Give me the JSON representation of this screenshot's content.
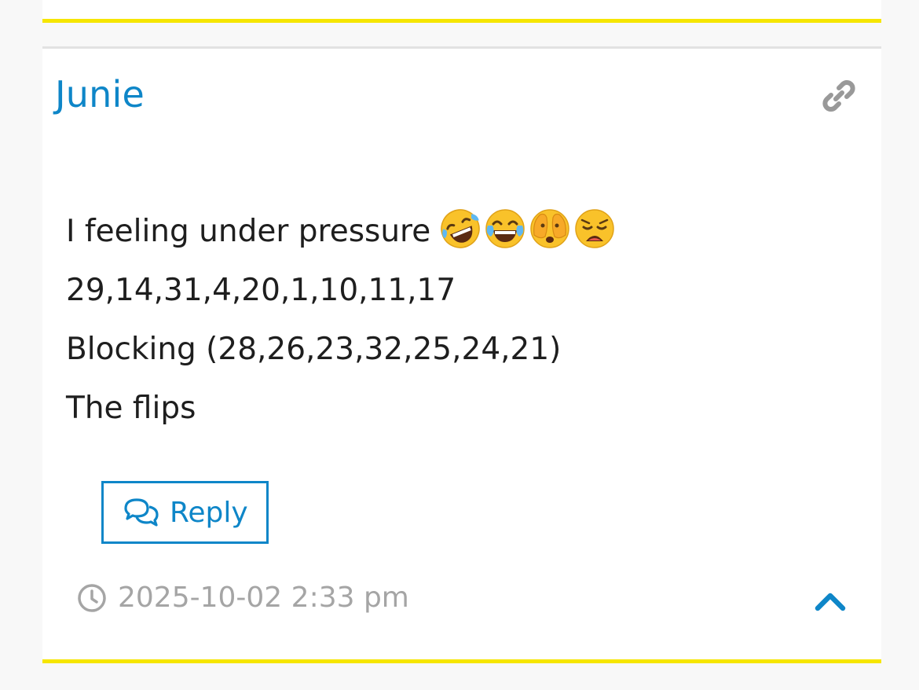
{
  "post": {
    "author": "Junie",
    "lines": [
      "I feeling under pressure",
      "29,14,31,4,20,1,10,11,17",
      "Blocking (28,26,23,32,25,24,21)",
      "The flips"
    ],
    "emojis": [
      "rolling-on-floor-laughing",
      "tears-of-joy",
      "face-with-open-eyes-and-hand-over-mouth",
      "weary-face"
    ],
    "reply_label": "Reply",
    "timestamp": "2025-10-02 2:33 pm"
  },
  "icons": {
    "permalink": "link-icon",
    "reply": "chat-bubbles-icon",
    "time": "clock-icon",
    "scroll_top": "chevron-up-icon"
  },
  "colors": {
    "accent": "#0e86c8",
    "highlight_border": "#f6e600",
    "text": "#1e1e1e",
    "muted": "#a5a5a5",
    "link_icon": "#999999"
  }
}
